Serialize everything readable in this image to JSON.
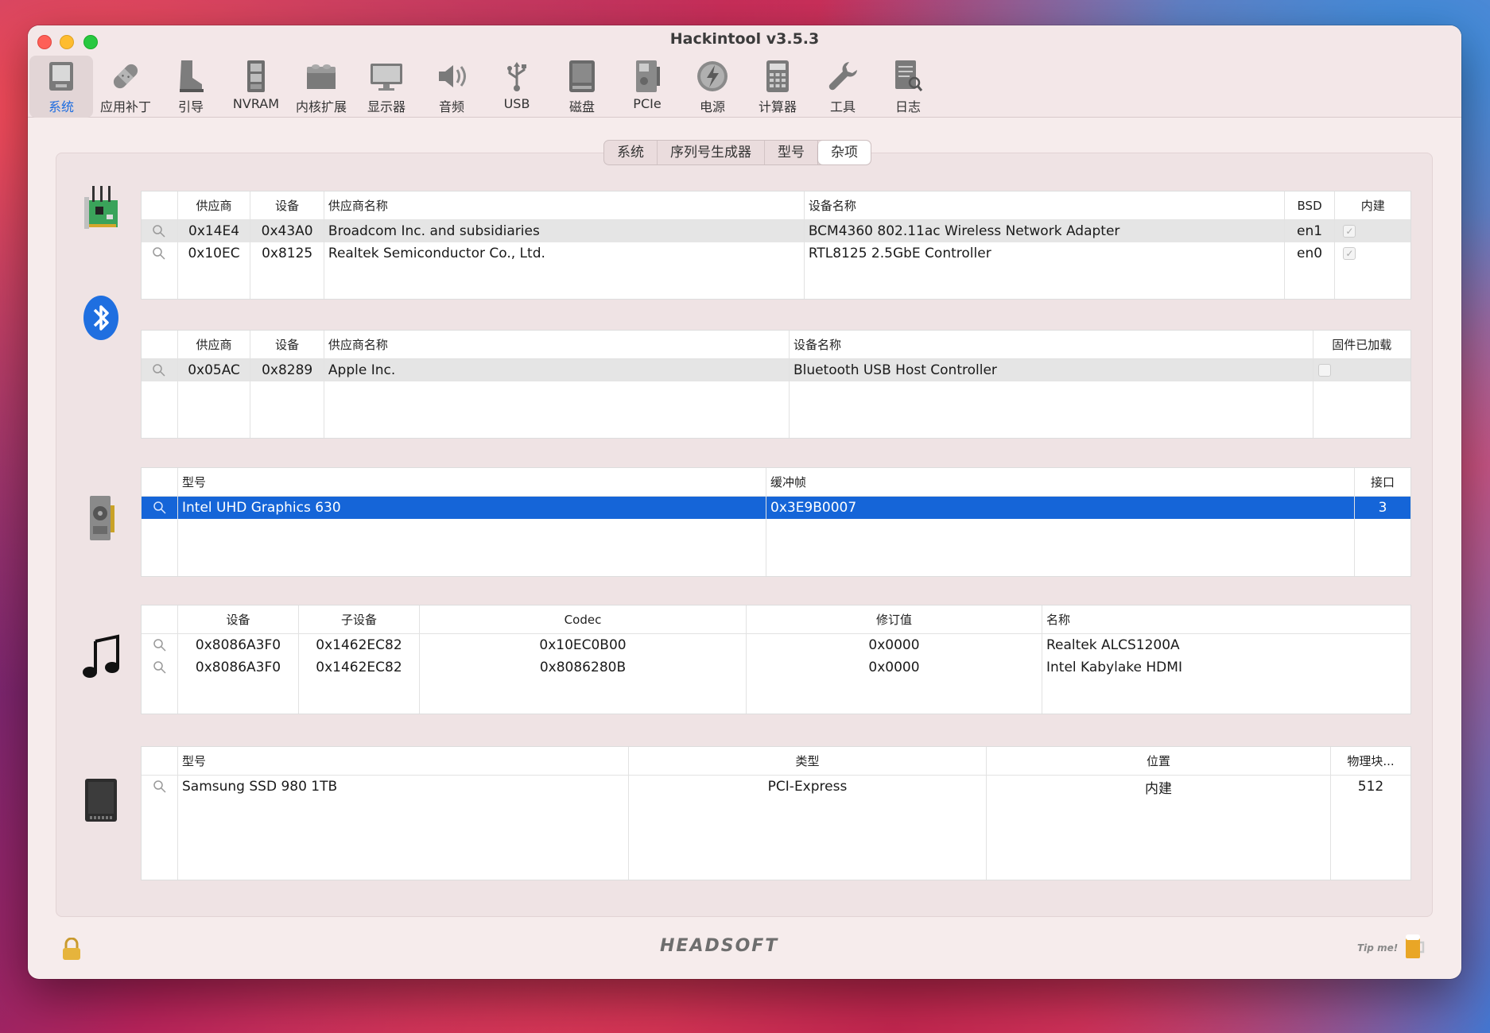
{
  "window": {
    "title": "Hackintool v3.5.3"
  },
  "toolbar": [
    {
      "label": "系统",
      "icon": "system-icon"
    },
    {
      "label": "应用补丁",
      "icon": "patch-icon"
    },
    {
      "label": "引导",
      "icon": "boot-icon"
    },
    {
      "label": "NVRAM",
      "icon": "nvram-icon"
    },
    {
      "label": "内核扩展",
      "icon": "kext-icon"
    },
    {
      "label": "显示器",
      "icon": "display-icon"
    },
    {
      "label": "音频",
      "icon": "audio-icon"
    },
    {
      "label": "USB",
      "icon": "usb-icon"
    },
    {
      "label": "磁盘",
      "icon": "disk-icon"
    },
    {
      "label": "PCIe",
      "icon": "pcie-icon"
    },
    {
      "label": "电源",
      "icon": "power-icon"
    },
    {
      "label": "计算器",
      "icon": "calculator-icon"
    },
    {
      "label": "工具",
      "icon": "tools-icon"
    },
    {
      "label": "日志",
      "icon": "log-icon"
    }
  ],
  "tabs": [
    "系统",
    "序列号生成器",
    "型号",
    "杂项"
  ],
  "network": {
    "headers": [
      "供应商",
      "设备",
      "供应商名称",
      "设备名称",
      "BSD",
      "内建"
    ],
    "rows": [
      {
        "vendor": "0x14E4",
        "device": "0x43A0",
        "vendor_name": "Broadcom Inc. and subsidiaries",
        "device_name": "BCM4360 802.11ac Wireless Network Adapter",
        "bsd": "en1"
      },
      {
        "vendor": "0x10EC",
        "device": "0x8125",
        "vendor_name": "Realtek Semiconductor Co., Ltd.",
        "device_name": "RTL8125 2.5GbE Controller",
        "bsd": "en0"
      }
    ]
  },
  "bluetooth": {
    "headers": [
      "供应商",
      "设备",
      "供应商名称",
      "设备名称",
      "固件已加载"
    ],
    "rows": [
      {
        "vendor": "0x05AC",
        "device": "0x8289",
        "vendor_name": "Apple Inc.",
        "device_name": "Bluetooth USB Host Controller"
      }
    ]
  },
  "graphics": {
    "headers": [
      "型号",
      "缓冲帧",
      "接口"
    ],
    "rows": [
      {
        "model": "Intel UHD Graphics 630",
        "framebuffer": "0x3E9B0007",
        "ports": "3"
      }
    ]
  },
  "audio": {
    "headers": [
      "设备",
      "子设备",
      "Codec",
      "修订值",
      "名称"
    ],
    "rows": [
      {
        "device": "0x8086A3F0",
        "subdevice": "0x1462EC82",
        "codec": "0x10EC0B00",
        "revision": "0x0000",
        "name": "Realtek ALCS1200A"
      },
      {
        "device": "0x8086A3F0",
        "subdevice": "0x1462EC82",
        "codec": "0x8086280B",
        "revision": "0x0000",
        "name": "Intel Kabylake HDMI"
      }
    ]
  },
  "storage": {
    "headers": [
      "型号",
      "类型",
      "位置",
      "物理块..."
    ],
    "rows": [
      {
        "model": "Samsung SSD 980 1TB",
        "type": "PCI-Express",
        "location": "内建",
        "block": "512"
      }
    ]
  },
  "footer": {
    "brand": "HEADSOFT",
    "tip": "Tip me!"
  }
}
